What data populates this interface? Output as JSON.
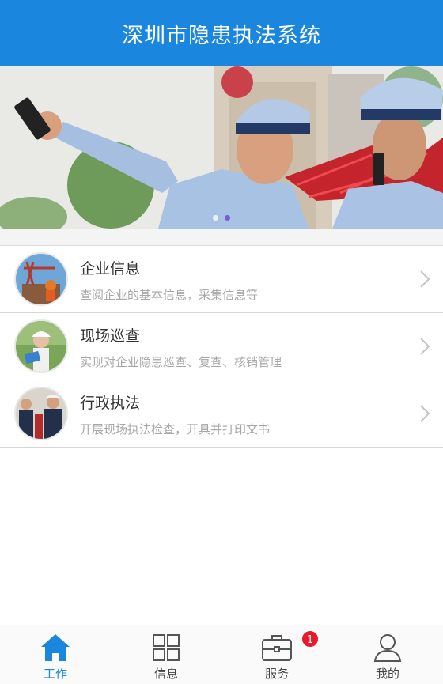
{
  "header": {
    "title": "深圳市隐患执法系统"
  },
  "banner": {
    "slide_count": 2,
    "active_slide": 2
  },
  "menu": [
    {
      "title": "企业信息",
      "subtitle": "查阅企业的基本信息，采集信息等"
    },
    {
      "title": "现场巡查",
      "subtitle": "实现对企业隐患巡查、复查、核销管理"
    },
    {
      "title": "行政执法",
      "subtitle": "开展现场执法检查，开具并打印文书"
    }
  ],
  "tabs": [
    {
      "label": "工作",
      "icon": "home-icon",
      "active": true
    },
    {
      "label": "信息",
      "icon": "grid-icon",
      "active": false
    },
    {
      "label": "服务",
      "icon": "toolbox-icon",
      "active": false,
      "badge": "1"
    },
    {
      "label": "我的",
      "icon": "user-icon",
      "active": false
    }
  ],
  "colors": {
    "primary": "#1a86dd",
    "badge": "#e8192c"
  }
}
